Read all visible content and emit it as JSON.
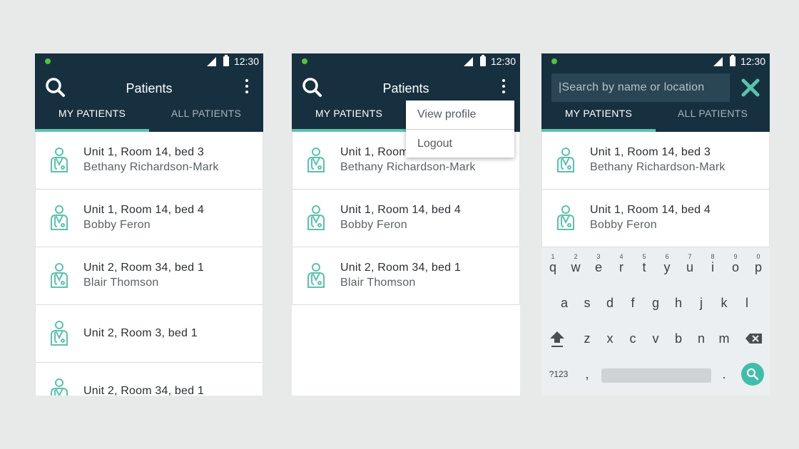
{
  "status": {
    "time": "12:30"
  },
  "app": {
    "title": "Patients",
    "tabs": {
      "my": "MY PATIENTS",
      "all": "ALL PATIENTS"
    }
  },
  "patients": [
    {
      "location": "Unit 1, Room 14, bed 3",
      "name": "Bethany Richardson-Mark"
    },
    {
      "location": "Unit 1, Room 14, bed 4",
      "name": "Bobby Feron"
    },
    {
      "location": "Unit 2, Room 34, bed 1",
      "name": "Blair Thomson"
    },
    {
      "location": "Unit 2, Room 3, bed 1",
      "name": ""
    },
    {
      "location": "Unit 2, Room 34, bed 1",
      "name": ""
    }
  ],
  "overflow_menu": {
    "view_profile": "View profile",
    "logout": "Logout"
  },
  "search": {
    "placeholder": "|Search by name or location"
  },
  "keyboard": {
    "row1": [
      {
        "k": "q",
        "n": "1"
      },
      {
        "k": "w",
        "n": "2"
      },
      {
        "k": "e",
        "n": "3"
      },
      {
        "k": "r",
        "n": "4"
      },
      {
        "k": "t",
        "n": "5"
      },
      {
        "k": "y",
        "n": "6"
      },
      {
        "k": "u",
        "n": "7"
      },
      {
        "k": "i",
        "n": "8"
      },
      {
        "k": "o",
        "n": "9"
      },
      {
        "k": "p",
        "n": "0"
      }
    ],
    "row2": [
      "a",
      "s",
      "d",
      "f",
      "g",
      "h",
      "j",
      "k",
      "l"
    ],
    "row3": [
      "z",
      "x",
      "c",
      "v",
      "b",
      "n",
      "m"
    ],
    "symbols": "?123",
    "comma": ",",
    "period": "."
  },
  "colors": {
    "appbar": "#17303f",
    "accent": "#5bc2ab",
    "status_dot": "#54c23b"
  },
  "icons": [
    "search-icon",
    "more-vert-icon",
    "doctor-icon",
    "close-icon",
    "shift-icon",
    "backspace-icon",
    "signal-icon",
    "battery-icon"
  ]
}
